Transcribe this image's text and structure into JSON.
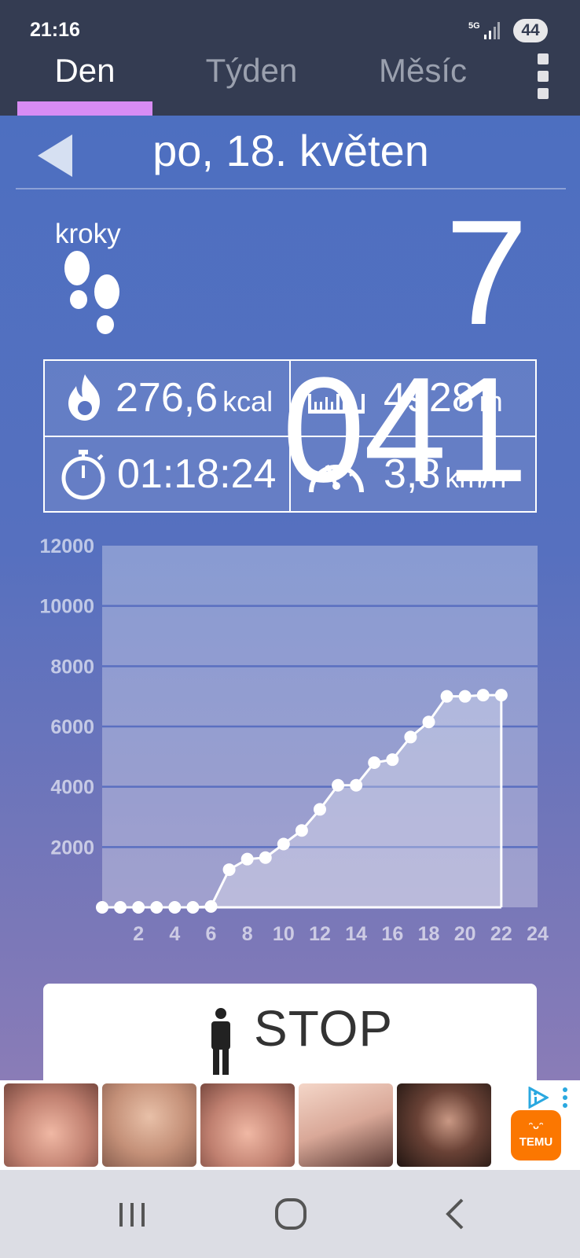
{
  "status_bar": {
    "time": "21:16",
    "network": "5G",
    "battery": "44"
  },
  "tabs": [
    {
      "label": "Den",
      "active": true
    },
    {
      "label": "Týden",
      "active": false
    },
    {
      "label": "Měsíc",
      "active": false
    }
  ],
  "date": "po, 18. květen",
  "steps": {
    "label": "kroky",
    "value": "7 041"
  },
  "stats": {
    "calories": {
      "value": "276,6",
      "unit": "kcal",
      "icon": "flame-icon"
    },
    "distance": {
      "value": "4928",
      "unit": "m",
      "icon": "ruler-icon"
    },
    "duration": {
      "value": "01:18:24",
      "icon": "stopwatch-icon"
    },
    "speed": {
      "value": "3,8",
      "unit": "km/h",
      "icon": "speedometer-icon"
    }
  },
  "chart_data": {
    "type": "area",
    "title": "",
    "xlabel": "",
    "ylabel": "",
    "x_ticks": [
      2,
      4,
      6,
      8,
      10,
      12,
      14,
      16,
      18,
      20,
      22,
      24
    ],
    "y_ticks": [
      2000,
      4000,
      6000,
      8000,
      10000,
      12000
    ],
    "xlim": [
      0,
      24
    ],
    "ylim": [
      0,
      12000
    ],
    "grid": true,
    "x": [
      0,
      1,
      2,
      3,
      4,
      5,
      6,
      7,
      8,
      9,
      10,
      11,
      12,
      13,
      14,
      15,
      16,
      17,
      18,
      19,
      20,
      21,
      22
    ],
    "values": [
      0,
      0,
      0,
      0,
      0,
      0,
      30,
      1250,
      1600,
      1650,
      2100,
      2550,
      3250,
      4050,
      4050,
      4800,
      4900,
      5650,
      6150,
      7000,
      7000,
      7041,
      7041
    ]
  },
  "stop_button": {
    "label": "STOP"
  },
  "ad": {
    "brand": "TEMU",
    "brand_glyphs": "ᵔᴗᵔ",
    "colors": {
      "temu": "#fb7701"
    }
  },
  "colors": {
    "topbar": "#343c52",
    "tab_indicator": "#d88cf4",
    "background_top": "#4d6fc0",
    "background_bottom": "#8a7cb7"
  }
}
